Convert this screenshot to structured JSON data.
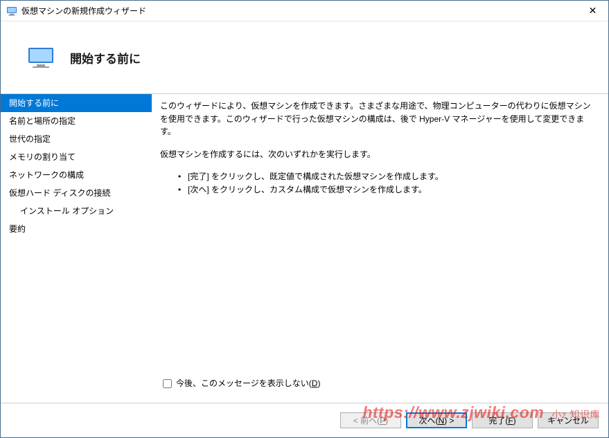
{
  "window": {
    "title": "仮想マシンの新規作成ウィザード",
    "close_glyph": "✕"
  },
  "header": {
    "title": "開始する前に"
  },
  "sidebar": {
    "items": [
      {
        "label": "開始する前に",
        "selected": true,
        "indented": false
      },
      {
        "label": "名前と場所の指定",
        "selected": false,
        "indented": false
      },
      {
        "label": "世代の指定",
        "selected": false,
        "indented": false
      },
      {
        "label": "メモリの割り当て",
        "selected": false,
        "indented": false
      },
      {
        "label": "ネットワークの構成",
        "selected": false,
        "indented": false
      },
      {
        "label": "仮想ハード ディスクの接続",
        "selected": false,
        "indented": false
      },
      {
        "label": "インストール オプション",
        "selected": false,
        "indented": true
      },
      {
        "label": "要約",
        "selected": false,
        "indented": false
      }
    ]
  },
  "content": {
    "paragraph1": "このウィザードにより、仮想マシンを作成できます。さまざまな用途で、物理コンピューターの代わりに仮想マシンを使用できます。このウィザードで行った仮想マシンの構成は、後で Hyper-V マネージャーを使用して変更できます。",
    "paragraph2": "仮想マシンを作成するには、次のいずれかを実行します。",
    "bullets": [
      "[完了] をクリックし、既定値で構成された仮想マシンを作成します。",
      "[次へ] をクリックし、カスタム構成で仮想マシンを作成します。"
    ],
    "checkbox_label_pre": "今後、このメッセージを表示しない(",
    "checkbox_label_u": "D",
    "checkbox_label_post": ")"
  },
  "buttons": {
    "prev_pre": "< 前へ(",
    "prev_u": "P",
    "prev_post": ")",
    "next_pre": "次へ(",
    "next_u": "N",
    "next_post": ") >",
    "finish_pre": "完了(",
    "finish_u": "F",
    "finish_post": ")",
    "cancel": "キャンセル"
  },
  "watermark": {
    "url": "https://www.zjwiki.com",
    "sub": "小z 知识库"
  }
}
